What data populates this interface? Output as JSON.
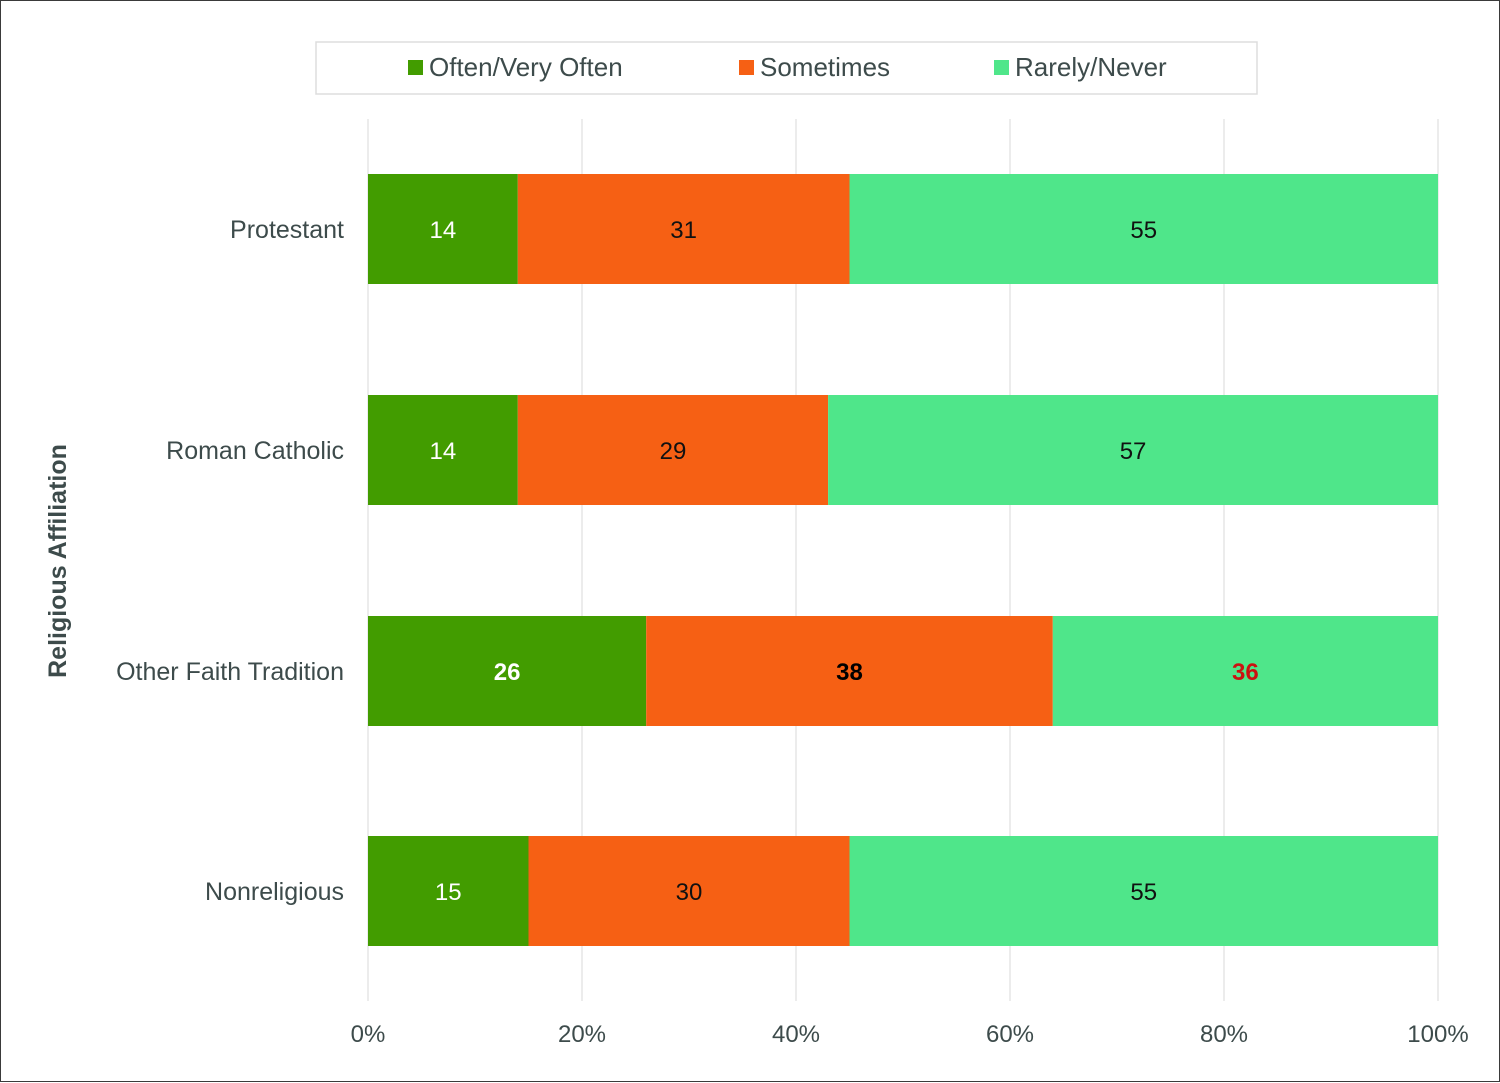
{
  "chart_data": {
    "type": "bar",
    "orientation": "horizontal",
    "stacked": true,
    "title": "",
    "xlabel": "",
    "ylabel": "Religious Affiliation",
    "xlim": [
      0,
      100
    ],
    "x_ticks": [
      0,
      20,
      40,
      60,
      80,
      100
    ],
    "x_tick_labels": [
      "0%",
      "20%",
      "40%",
      "60%",
      "80%",
      "100%"
    ],
    "grid": "vertical",
    "legend_position": "top",
    "categories": [
      "Protestant",
      "Roman Catholic",
      "Other Faith Tradition",
      "Nonreligious"
    ],
    "series": [
      {
        "name": "Often/Very Often",
        "color": "#429c00",
        "values": [
          14,
          14,
          26,
          15
        ],
        "label_colors": [
          "#ffffff",
          "#ffffff",
          "#ffffff",
          "#ffffff"
        ]
      },
      {
        "name": "Sometimes",
        "color": "#f66014",
        "values": [
          31,
          29,
          38,
          30
        ],
        "label_colors": [
          "#111111",
          "#111111",
          "#000000",
          "#111111"
        ]
      },
      {
        "name": "Rarely/Never",
        "color": "#4fe68a",
        "values": [
          55,
          57,
          36,
          55
        ],
        "label_colors": [
          "#111111",
          "#111111",
          "#cc1111",
          "#111111"
        ]
      }
    ],
    "bold_categories": [
      "Other Faith Tradition"
    ]
  }
}
